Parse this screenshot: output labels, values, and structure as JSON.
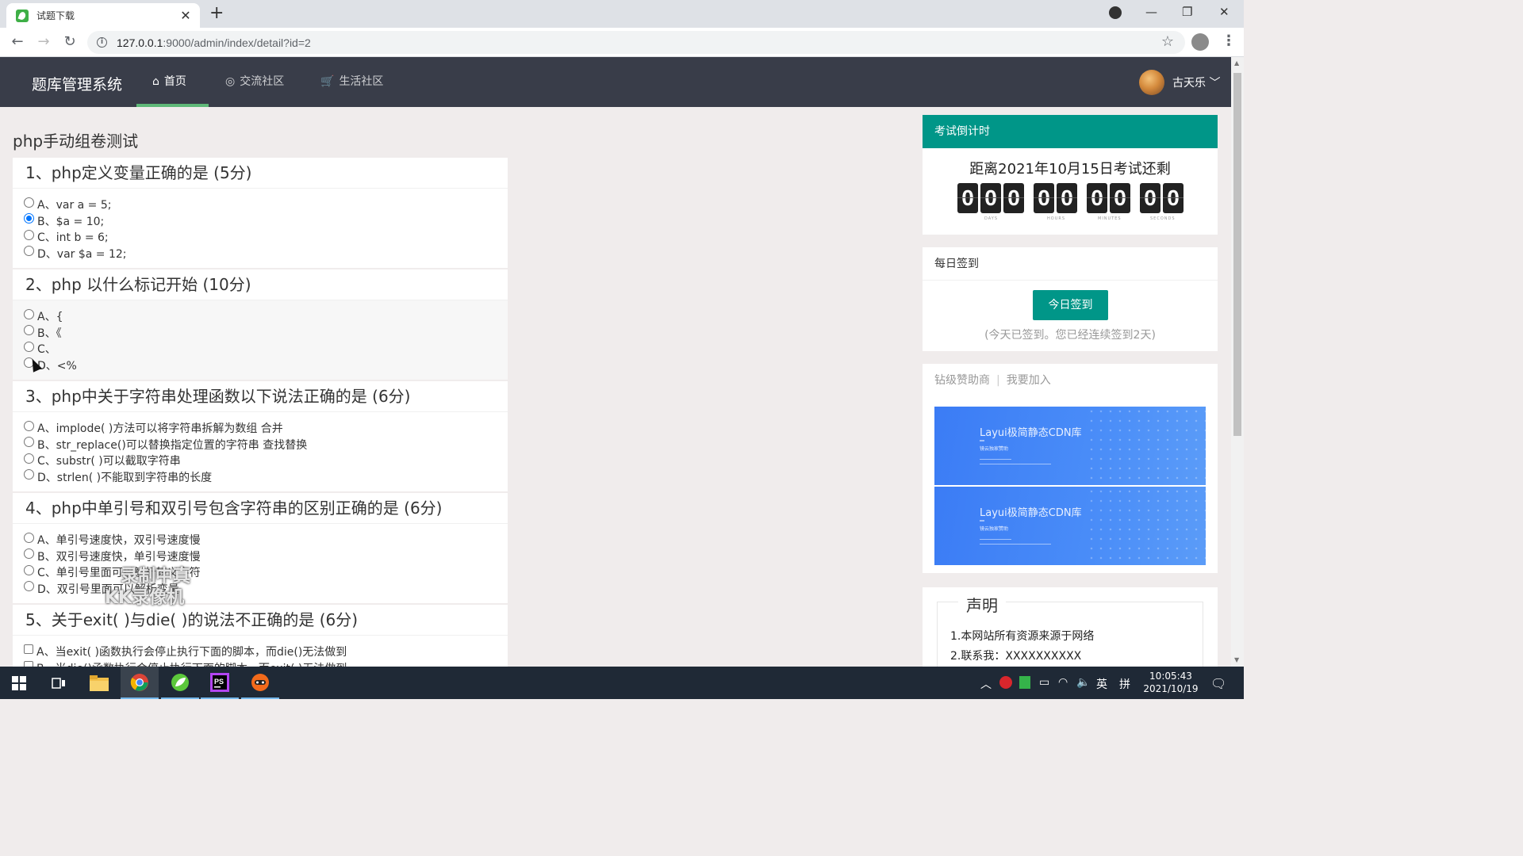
{
  "browser": {
    "tab_title": "试题下载",
    "tab_close": "✕",
    "new_tab": "+",
    "url_host": "127.0.0.1",
    "url_rest": ":9000/admin/index/detail?id=2",
    "minimize": "—",
    "restore": "❐",
    "close": "✕"
  },
  "header": {
    "logo": "题库管理系统",
    "nav": [
      {
        "label": "首页",
        "icon": "home-icon"
      },
      {
        "label": "交流社区",
        "icon": "chat-icon"
      },
      {
        "label": "生活社区",
        "icon": "cart-icon"
      }
    ],
    "username": "古天乐"
  },
  "quiz": {
    "title": "php手动组卷测试",
    "questions": [
      {
        "title": "1、php定义变量正确的是 (5分)",
        "type": "radio",
        "selected": 1,
        "options": [
          "A、var a = 5;",
          "B、$a = 10;",
          "C、int b = 6;",
          "D、var $a = 12;"
        ]
      },
      {
        "title": "2、php 以什么标记开始 (10分)",
        "type": "radio",
        "selected": -1,
        "options": [
          "A、{",
          "B、《",
          "C、",
          "D、<%"
        ]
      },
      {
        "title": "3、php中关于字符串处理函数以下说法正确的是 (6分)",
        "type": "radio",
        "selected": -1,
        "options": [
          "A、implode( )方法可以将字符串拆解为数组 合并",
          "B、str_replace()可以替换指定位置的字符串 查找替换",
          "C、substr( )可以截取字符串",
          "D、strlen( )不能取到字符串的长度"
        ]
      },
      {
        "title": "4、php中单引号和双引号包含字符串的区别正确的是 (6分)",
        "type": "radio",
        "selected": -1,
        "options": [
          "A、单引号速度快，双引号速度慢",
          "B、双引号速度快，单引号速度慢",
          "C、单引号里面可以解析转义字符",
          "D、双引号里面可以解析变量"
        ]
      },
      {
        "title": "5、关于exit( )与die( )的说法不正确的是 (6分)",
        "type": "checkbox",
        "options": [
          "A、当exit( )函数执行会停止执行下面的脚本，而die()无法做到",
          "B、当die()函数执行会停止执行下面的脚本，而exit( )无法做到"
        ]
      }
    ]
  },
  "watermark": [
    "录制中真",
    "KK录像机"
  ],
  "sidebar": {
    "countdown": {
      "header": "考试倒计时",
      "title": "距离2021年10月15日考试还剩",
      "digits": [
        "0",
        "0",
        "0",
        "0",
        "0",
        "0",
        "0",
        "0",
        "0"
      ],
      "captions": [
        "DAYS",
        "HOURS",
        "MINUTES",
        "SECONDS"
      ]
    },
    "signin": {
      "header": "每日签到",
      "button": "今日签到",
      "note": "(今天已签到。您已经连续签到2天)"
    },
    "sponsor": {
      "link1": "钻级赞助商",
      "sep": "|",
      "link2": "我要加入",
      "ads": [
        {
          "title": "Layui极简静态CDN库",
          "sub": "镜云独家赞助"
        },
        {
          "title": "Layui极简静态CDN库",
          "sub": "镜云独家赞助"
        }
      ]
    },
    "notice": {
      "legend": "声明",
      "lines": [
        "1.本网站所有资源来源于网络",
        "2.联系我：XXXXXXXXXX"
      ]
    }
  },
  "taskbar": {
    "clock_time": "10:05:43",
    "clock_date": "2021/10/19",
    "ime": "英",
    "ime2": "拼"
  },
  "colors": {
    "header_bg": "#393d49",
    "accent_green": "#009688",
    "nav_underline": "#5fb878",
    "page_bg": "#f0ecec"
  }
}
